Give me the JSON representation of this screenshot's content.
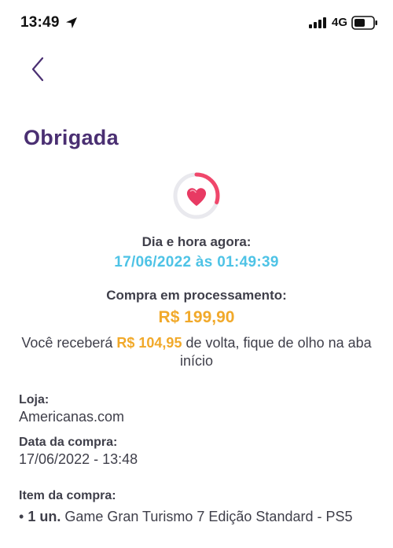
{
  "status_bar": {
    "time": "13:49",
    "network": "4G",
    "icons": [
      "location-arrow-icon",
      "signal-icon",
      "battery-icon"
    ]
  },
  "header": {
    "back_icon": "chevron-left-icon",
    "title": "Obrigada"
  },
  "status_icon": {
    "name": "heart-progress-ring",
    "progress_fraction": 0.3,
    "colors": {
      "ring": "#e9e9ee",
      "progress": "#f0476b",
      "heart": "#e83a63"
    }
  },
  "datetime": {
    "label": "Dia e hora agora:",
    "value": "17/06/2022 às 01:49:39"
  },
  "purchase": {
    "status_label": "Compra em processamento:",
    "price": "R$ 199,90"
  },
  "cashback": {
    "prefix": "Você receberá ",
    "amount": "R$ 104,95",
    "suffix": " de volta, fique de olho na aba início"
  },
  "details": {
    "store_label": "Loja:",
    "store_value": "Americanas.com",
    "date_label": "Data da compra:",
    "date_value": "17/06/2022 - 13:48",
    "item_label": "Item da compra:",
    "items": [
      {
        "bullet": "• ",
        "quantity": "1 un.",
        "name": " Game Gran Turismo 7 Edição Standard - PS5"
      }
    ]
  },
  "colors": {
    "title": "#4a2f72",
    "datetime": "#4ec3e6",
    "price": "#f1a92a",
    "text": "#3f3f4a"
  }
}
